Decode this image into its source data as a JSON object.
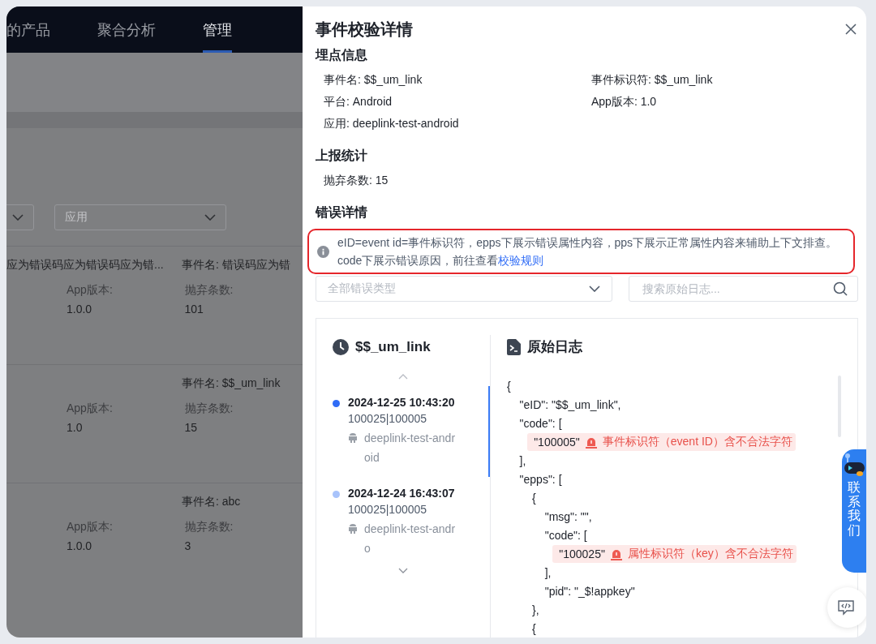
{
  "background": {
    "nav_tabs": [
      {
        "label": "的产品",
        "selected": false
      },
      {
        "label": "聚合分析",
        "selected": false
      },
      {
        "label": "管理",
        "selected": true
      }
    ],
    "filters": [
      {
        "kind": "select"
      },
      {
        "kind": "select",
        "placeholder": "应用"
      }
    ],
    "cards": [
      {
        "left_text": "应为错误码应为错误码应为错...",
        "event_name": "事件名: 错误码应为错",
        "fields": [
          {
            "label": "App版本:",
            "value": "1.0.0"
          },
          {
            "label": "抛弃条数:",
            "value": "101"
          }
        ]
      },
      {
        "event_name": "事件名: $$_um_link",
        "fields": [
          {
            "label": "App版本:",
            "value": "1.0"
          },
          {
            "label": "抛弃条数:",
            "value": "15"
          }
        ]
      },
      {
        "event_name": "事件名: abc",
        "fields": [
          {
            "label": "App版本:",
            "value": "1.0.0"
          },
          {
            "label": "抛弃条数:",
            "value": "3"
          }
        ]
      }
    ]
  },
  "drawer": {
    "title": "事件校验详情",
    "sections": [
      {
        "title": "埋点信息",
        "items": [
          "事件名: $$_um_link",
          "事件标识符: $$_um_link",
          "平台: Android",
          "App版本: 1.0",
          "应用: deeplink-test-android"
        ]
      },
      {
        "title": "上报统计",
        "items": [
          "抛弃条数: 15"
        ]
      },
      {
        "title": "错误详情"
      }
    ],
    "alert": {
      "text": "eID=event id=事件标识符，epps下展示错误属性内容，pps下展示正常属性内容来辅助上下文排查。code下展示错误原因，前往查看",
      "link": "校验规则"
    },
    "error_type_select": {
      "placeholder": "全部错误类型"
    },
    "search": {
      "placeholder": "搜索原始日志..."
    },
    "event_panel": {
      "title": "$$_um_link",
      "entries": [
        {
          "selected": true,
          "time": "2024-12-25 10:43:20",
          "codes": "100025|100005",
          "app": "deeplink-test-android"
        },
        {
          "selected": false,
          "time": "2024-12-24 16:43:07",
          "codes": "100025|100005",
          "app": "deeplink-test-andro"
        }
      ]
    },
    "log_panel": {
      "title": "原始日志",
      "lines": [
        {
          "kind": "plain",
          "text": "{"
        },
        {
          "kind": "plain",
          "text": "    \"eID\": \"$$_um_link\","
        },
        {
          "kind": "plain",
          "text": "    \"code\": ["
        },
        {
          "kind": "error",
          "text": "        \"100005\"",
          "message": "事件标识符（event ID）含不合法字符"
        },
        {
          "kind": "plain",
          "text": "    ],"
        },
        {
          "kind": "plain",
          "text": "    \"epps\": ["
        },
        {
          "kind": "plain",
          "text": "        {"
        },
        {
          "kind": "plain",
          "text": "            \"msg\": \"\","
        },
        {
          "kind": "plain",
          "text": "            \"code\": ["
        },
        {
          "kind": "error",
          "text": "                \"100025\"",
          "message": "属性标识符（key）含不合法字符"
        },
        {
          "kind": "plain",
          "text": "            ],"
        },
        {
          "kind": "plain",
          "text": "            \"pid\": \"_$!appkey\""
        },
        {
          "kind": "plain",
          "text": "        },"
        },
        {
          "kind": "plain",
          "text": "        {"
        }
      ]
    }
  },
  "contact_widget": {
    "label": "联系我们"
  }
}
